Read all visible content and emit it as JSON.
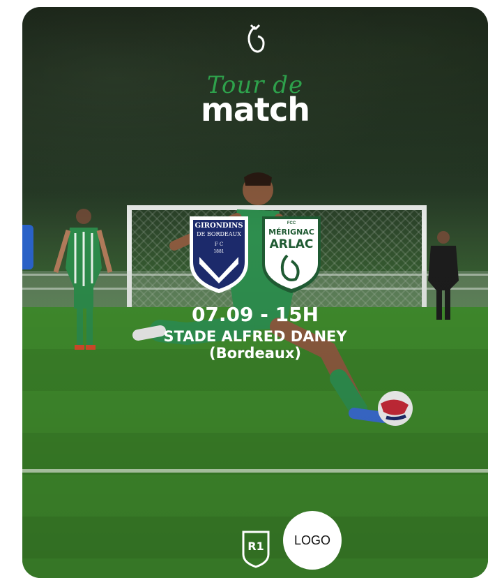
{
  "poster": {
    "title_script": "Tour de",
    "title_main": "match",
    "home_team": {
      "name_line1": "GIRONDINS",
      "name_line2": "DE BORDEAUX",
      "abbr": "F C",
      "year": "1881",
      "color": "#1c2a6b"
    },
    "away_team": {
      "prefix": "FCC",
      "name_line1": "MÉRIGNAC",
      "name_line2": "ARLAC",
      "color": "#ffffff"
    },
    "date_time": "07.09 - 15H",
    "venue": "STADE ALFRED DANEY",
    "city": "(Bordeaux)",
    "league_badge": "R1",
    "logo_placeholder": "LOGO"
  },
  "colors": {
    "accent_green": "#2fa84f",
    "pitch": "#3f8a2c",
    "text": "#ffffff"
  }
}
